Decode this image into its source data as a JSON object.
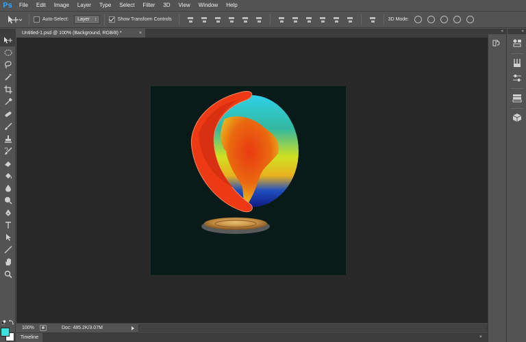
{
  "app": {
    "logo": "Ps",
    "brand_color": "#31a8ff"
  },
  "menu": [
    "File",
    "Edit",
    "Image",
    "Layer",
    "Type",
    "Select",
    "Filter",
    "3D",
    "View",
    "Window",
    "Help"
  ],
  "options_bar": {
    "tool_icon": "move-tool-icon",
    "auto_select_label": "Auto-Select:",
    "auto_select_checked": false,
    "auto_select_target": "Layer",
    "show_transform_label": "Show Transform Controls",
    "show_transform_checked": true,
    "mode_3d_label": "3D Mode:"
  },
  "document": {
    "tab_title": "Untitled-1.psd @ 100% (Background, RGB/8) *",
    "close_glyph": "×",
    "canvas_color": "#091b19"
  },
  "status_bar": {
    "zoom": "100%",
    "doc_size": "Doc: 485.2K/3.07M"
  },
  "timeline": {
    "tab_label": "Timeline",
    "collapse_glyph": "»"
  },
  "colors": {
    "foreground": "#41e0e0",
    "background": "#ffffff"
  },
  "tools": [
    "move",
    "elliptical-marquee",
    "lasso",
    "quick-selection",
    "crop",
    "eyedropper",
    "spot-healing",
    "brush",
    "clone-stamp",
    "history-brush",
    "eraser",
    "paint-bucket",
    "blur",
    "dodge",
    "pen",
    "type",
    "path-selection",
    "line",
    "hand",
    "zoom"
  ],
  "right_dock": {
    "collapse_glyph": "«",
    "col_a": [
      "history-icon"
    ],
    "col_b": [
      "adjustments-icon",
      "brush-preset-icon",
      "properties-icon",
      "layers-icon",
      "3d-cube-icon"
    ]
  }
}
